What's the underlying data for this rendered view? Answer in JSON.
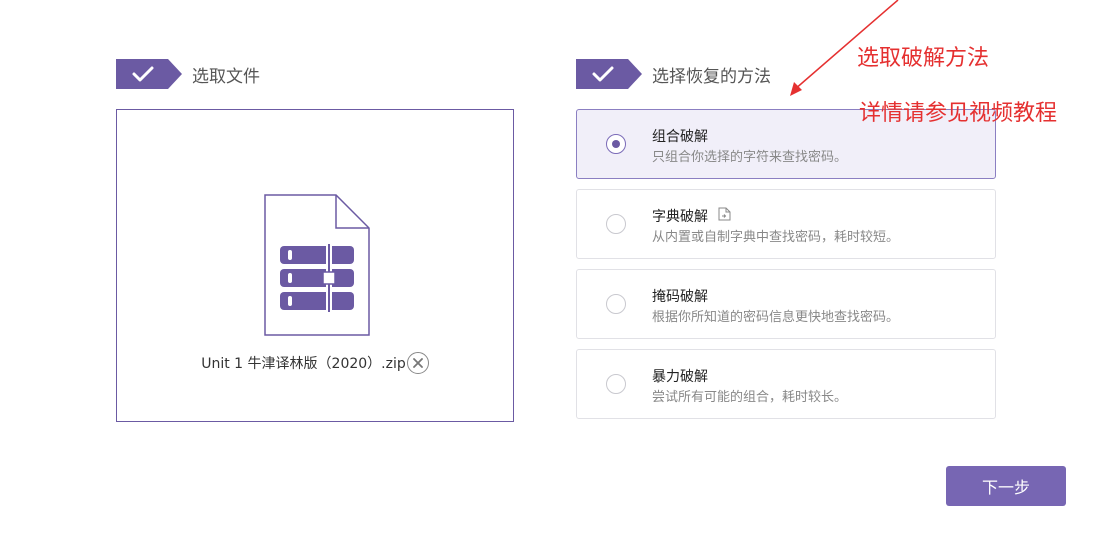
{
  "steps": {
    "select_file": {
      "title": "选取文件"
    },
    "select_method": {
      "title": "选择恢复的方法"
    }
  },
  "file": {
    "name": "Unit 1 牛津译林版（2020）.zip",
    "icon": "zip-archive-icon",
    "remove_icon": "close-circle-icon"
  },
  "methods": [
    {
      "name": "组合破解",
      "desc": "只组合你选择的字符来查找密码。",
      "selected": true
    },
    {
      "name": "字典破解",
      "desc": "从内置或自制字典中查找密码，耗时较短。",
      "selected": false,
      "icon": "import-file-icon"
    },
    {
      "name": "掩码破解",
      "desc": "根据你所知道的密码信息更快地查找密码。",
      "selected": false
    },
    {
      "name": "暴力破解",
      "desc": "尝试所有可能的组合，耗时较长。",
      "selected": false
    }
  ],
  "next_button": {
    "label": "下一步"
  },
  "annotations": {
    "line1": "选取破解方法",
    "line2": "详情请参见视频教程"
  },
  "colors": {
    "accent": "#6b5aa3",
    "button": "#7766b3",
    "selected_bg": "#f1eff9",
    "annotation": "#e53030"
  }
}
